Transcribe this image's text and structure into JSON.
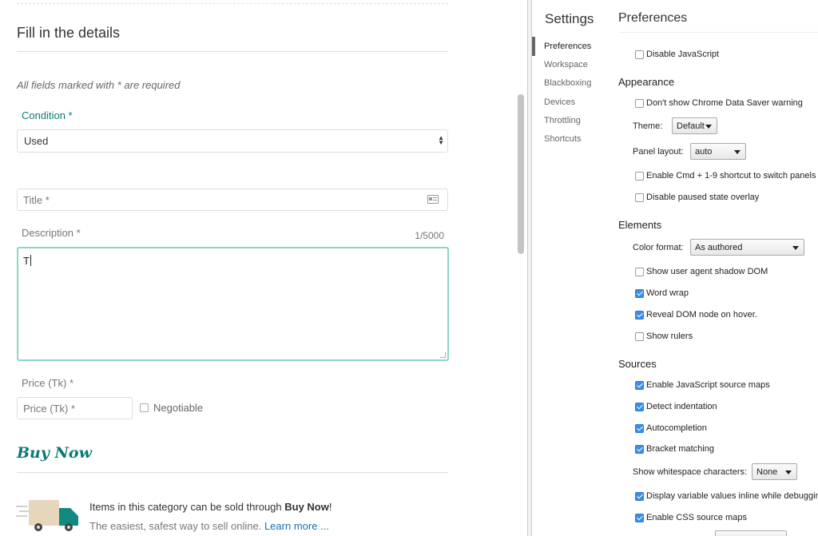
{
  "form": {
    "heading": "Fill in the details",
    "required_note": "All fields marked with * are required",
    "condition": {
      "label": "Condition *",
      "value": "Used"
    },
    "title_field": {
      "placeholder": "Title *"
    },
    "description": {
      "label": "Description *",
      "counter": "1/5000",
      "value": "T"
    },
    "price": {
      "label": "Price (Tk) *",
      "placeholder": "Price (Tk) *",
      "negotiable_label": "Negotiable"
    },
    "buy_now": {
      "title": "Buy Now",
      "line1_prefix": "Items in this category can be sold through ",
      "line1_bold": "Buy Now",
      "line1_suffix": "!",
      "line2_prefix": "The easiest, safest way to sell online. ",
      "learn_more": "Learn more ..."
    }
  },
  "settings": {
    "title": "Settings",
    "nav": [
      "Preferences",
      "Workspace",
      "Blackboxing",
      "Devices",
      "Throttling",
      "Shortcuts"
    ],
    "active_nav": "Preferences",
    "panel_title": "Preferences",
    "disable_js": {
      "label": "Disable JavaScript",
      "checked": false
    },
    "appearance": {
      "heading": "Appearance",
      "data_saver": {
        "label": "Don't show Chrome Data Saver warning",
        "checked": false
      },
      "theme_label": "Theme:",
      "theme_value": "Default",
      "panel_layout_label": "Panel layout:",
      "panel_layout_value": "auto",
      "cmd_shortcut": {
        "label": "Enable Cmd + 1-9 shortcut to switch panels",
        "checked": false
      },
      "paused_overlay": {
        "label": "Disable paused state overlay",
        "checked": false
      }
    },
    "elements": {
      "heading": "Elements",
      "color_format_label": "Color format:",
      "color_format_value": "As authored",
      "shadow_dom": {
        "label": "Show user agent shadow DOM",
        "checked": false
      },
      "word_wrap": {
        "label": "Word wrap",
        "checked": true
      },
      "reveal_dom": {
        "label": "Reveal DOM node on hover.",
        "checked": true
      },
      "rulers": {
        "label": "Show rulers",
        "checked": false
      }
    },
    "sources": {
      "heading": "Sources",
      "js_source_maps": {
        "label": "Enable JavaScript source maps",
        "checked": true
      },
      "detect_indent": {
        "label": "Detect indentation",
        "checked": true
      },
      "autocompletion": {
        "label": "Autocompletion",
        "checked": true
      },
      "bracket_matching": {
        "label": "Bracket matching",
        "checked": true
      },
      "whitespace_label": "Show whitespace characters:",
      "whitespace_value": "None",
      "inline_values": {
        "label": "Display variable values inline while debugging",
        "checked": true
      },
      "css_source_maps": {
        "label": "Enable CSS source maps",
        "checked": true
      }
    }
  },
  "colors": {
    "teal": "#0b7a76",
    "focus_border": "#8ad6c9",
    "link": "#1a6fb5",
    "checkbox_on": "#3b8de8"
  }
}
